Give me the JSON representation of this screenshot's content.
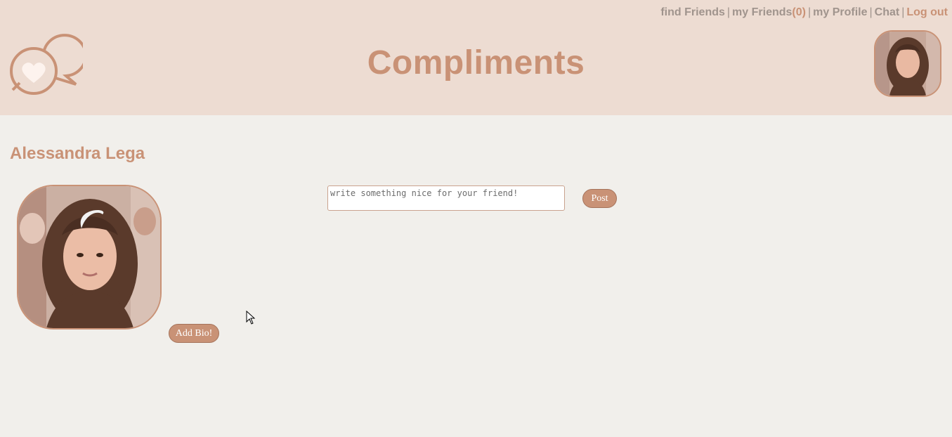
{
  "nav": {
    "find_friends": "find Friends",
    "my_friends": "my Friends",
    "friends_count": "(0)",
    "my_profile": "my Profile",
    "chat": "Chat",
    "logout": "Log out",
    "separator": "|"
  },
  "header": {
    "title": "Compliments",
    "logo_icon": "speech-bubbles-heart-icon"
  },
  "profile": {
    "name": "Alessandra Lega",
    "add_bio_label": "Add Bio!"
  },
  "compliment": {
    "placeholder": "write something nice for your friend!",
    "post_label": "Post"
  },
  "colors": {
    "header_bg": "#eddcd2",
    "page_bg": "#f1efeb",
    "accent": "#c99276",
    "nav_text": "#a0948d"
  }
}
